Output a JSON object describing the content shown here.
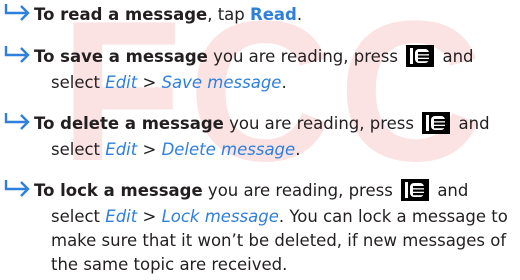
{
  "watermark": "FCC",
  "items": [
    {
      "lines": [
        {
          "bold": "To read a message",
          "text": ", tap ",
          "link": "Read",
          "end": "."
        }
      ]
    },
    {
      "lines": [
        {
          "bold": "To save a message",
          "text": " you are reading, press ",
          "after": " and"
        },
        {
          "text": "select ",
          "menu": "Edit",
          "sep": " > ",
          "action": "Save message",
          "end": "."
        }
      ]
    },
    {
      "lines": [
        {
          "bold": "To delete a message",
          "text": " you are reading, press ",
          "after": " and"
        },
        {
          "text": "select ",
          "menu": "Edit",
          "sep": " > ",
          "action": "Delete message",
          "end": "."
        }
      ]
    },
    {
      "lines": [
        {
          "bold": "To lock a message",
          "text": " you are reading, press ",
          "after": " and"
        },
        {
          "text": "select ",
          "menu": "Edit",
          "sep": " > ",
          "action": "Lock message",
          "end": ". You can lock a message to"
        },
        {
          "text": "make sure that it won’t be deleted, if new messages of"
        },
        {
          "text": "the same topic are received."
        }
      ]
    }
  ],
  "icons": {
    "bullet": "arrow-right-icon",
    "menu_key": "menu-key-icon"
  },
  "colors": {
    "link": "#2f7fdc",
    "watermark": "#fbe3e3",
    "text": "#231f20"
  }
}
